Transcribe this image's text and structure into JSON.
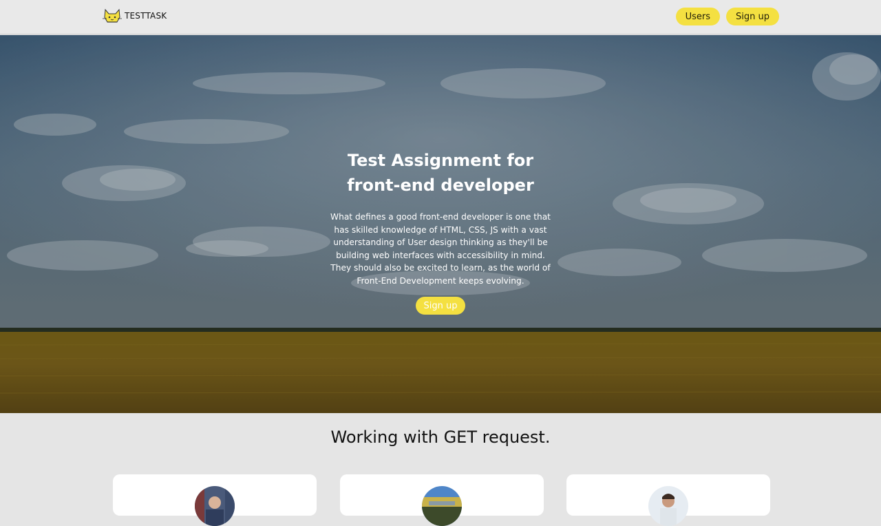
{
  "header": {
    "logo_text": "TESTTASK",
    "nav": {
      "users_label": "Users",
      "signup_label": "Sign up"
    }
  },
  "hero": {
    "title_line1": "Test Assignment for",
    "title_line2": "front-end developer",
    "description_lines": [
      "What defines a good front-end developer is one that",
      "has skilled knowledge of HTML, CSS, JS with a vast",
      "understanding of User design thinking as they'll be",
      "building web interfaces with accessibility in mind.",
      "They should also be excited to learn, as the world of",
      "Front-End Development keeps evolving."
    ],
    "button_label": "Sign up"
  },
  "users_section": {
    "title": "Working with GET request."
  },
  "colors": {
    "accent": "#f4e041",
    "page_bg": "#e5e5e5",
    "header_bg": "#e9e9e9",
    "card_bg": "#ffffff"
  },
  "icons": {
    "logo": "cat-logo-icon"
  }
}
